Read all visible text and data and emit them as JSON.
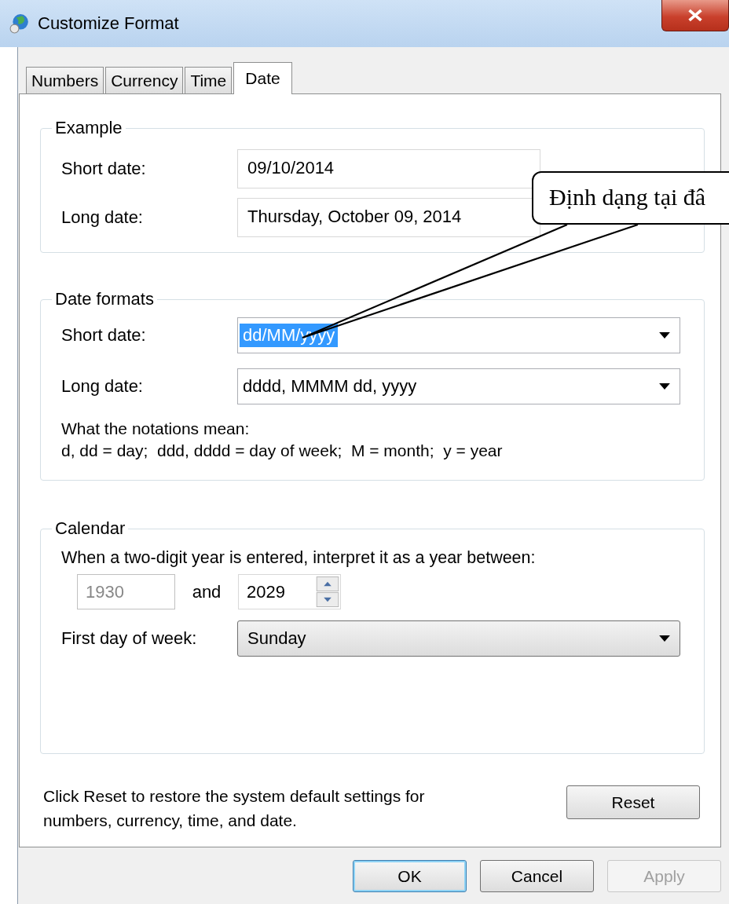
{
  "window": {
    "title": "Customize Format"
  },
  "tabs": [
    {
      "label": "Numbers",
      "selected": false
    },
    {
      "label": "Currency",
      "selected": false
    },
    {
      "label": "Time",
      "selected": false
    },
    {
      "label": "Date",
      "selected": true
    }
  ],
  "example": {
    "title": "Example",
    "rows": [
      {
        "label": "Short date:",
        "value": "09/10/2014"
      },
      {
        "label": "Long date:",
        "value": "Thursday, October 09, 2014"
      }
    ]
  },
  "date_formats": {
    "title": "Date formats",
    "rows": [
      {
        "label": "Short date:",
        "value": "dd/MM/yyyy",
        "text_selected": true
      },
      {
        "label": "Long date:",
        "value": "dddd, MMMM dd, yyyy",
        "text_selected": false
      }
    ],
    "notes": [
      "What the notations mean:",
      "d, dd = day;  ddd, dddd = day of week;  M = month;  y = year"
    ]
  },
  "calendar": {
    "title": "Calendar",
    "prompt": "When a two-digit year is entered, interpret it as a year between:",
    "from_year": {
      "value": "1930",
      "disabled": true
    },
    "joiner": "and",
    "to_year": {
      "value": "2029",
      "disabled": false
    },
    "first_day_label": "First day of week:",
    "first_day": "Sunday"
  },
  "reset_note": "Click Reset to restore the system default settings for numbers, currency, time, and date.",
  "reset_button": "Reset",
  "buttons": [
    {
      "label": "OK",
      "default": true,
      "disabled": false
    },
    {
      "label": "Cancel",
      "default": false,
      "disabled": false
    },
    {
      "label": "Apply",
      "default": false,
      "disabled": true
    }
  ],
  "callout": {
    "text": "Định dạng tại đâ"
  }
}
